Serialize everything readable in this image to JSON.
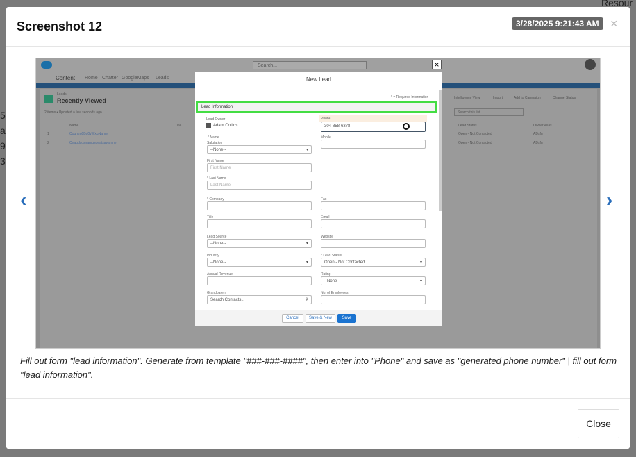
{
  "background_fragments": [
    "Resour",
    "5",
    "at",
    "9:",
    "3"
  ],
  "modal": {
    "title": "Screenshot 12",
    "timestamp": "3/28/2025 9:21:43 AM",
    "close_x": "×",
    "prev": "‹",
    "next": "›",
    "caption": "Fill out form \"lead information\". Generate from template \"###-###-####\", then enter into \"Phone\" and save as \"generated phone number\" | fill out form \"lead information\".",
    "close_label": "Close"
  },
  "screenshot": {
    "search": "Search...",
    "app_name": "Content",
    "tabs": [
      "Home",
      "Chatter",
      "GoogleMaps",
      "Leads"
    ],
    "object": "Leads",
    "list_view": "Recently Viewed",
    "list_status": "2 items • Updated a few seconds ago",
    "columns": [
      "Name",
      "Title",
      "Lead Status",
      "Owner Alias"
    ],
    "rows": [
      {
        "num": "1",
        "name": "Countm0Bd0vWxuNamer",
        "status": "Open - Not Contacted",
        "owner": "ADsfu"
      },
      {
        "num": "2",
        "name": "Cnagdsosnamgsgeatsavanme",
        "status": "Open - Not Contacted",
        "owner": "ADsfu"
      }
    ],
    "actions": [
      "Intelligence View",
      "Import",
      "Add to Campaign",
      "Change Status"
    ],
    "search_list": "Search this list...",
    "dialog": {
      "title": "New Lead",
      "required": "* = Required Information",
      "section": "Lead Information",
      "owner_label": "Lead Owner",
      "owner_value": "Adam Collins",
      "name_label": "* Name",
      "fields": [
        {
          "label": "Salutation",
          "value": "--None--",
          "type": "select"
        },
        {
          "label": "First Name",
          "value": "First Name",
          "type": "input"
        },
        {
          "label": "* Last Name",
          "value": "Last Name",
          "type": "input"
        },
        {
          "label": "* Company",
          "value": "",
          "type": "input"
        },
        {
          "label": "Title",
          "value": "",
          "type": "input"
        },
        {
          "label": "Lead Source",
          "value": "--None--",
          "type": "select"
        },
        {
          "label": "Industry",
          "value": "--None--",
          "type": "select"
        },
        {
          "label": "Annual Revenue",
          "value": "",
          "type": "input"
        },
        {
          "label": "Grandparent",
          "value": "Search Contacts...",
          "type": "search"
        },
        {
          "label": "Phone",
          "value": "304-858-6378",
          "type": "input"
        },
        {
          "label": "Mobile",
          "value": "",
          "type": "input"
        },
        {
          "label": "Fax",
          "value": "",
          "type": "input"
        },
        {
          "label": "Email",
          "value": "",
          "type": "input"
        },
        {
          "label": "Website",
          "value": "",
          "type": "input"
        },
        {
          "label": "* Lead Status",
          "value": "Open - Not Contacted",
          "type": "select"
        },
        {
          "label": "Rating",
          "value": "--None--",
          "type": "select"
        },
        {
          "label": "No. of Employees",
          "value": "",
          "type": "input"
        }
      ],
      "cancel": "Cancel",
      "save_new": "Save & New",
      "save": "Save"
    },
    "highlight_color": "#44dd44"
  }
}
